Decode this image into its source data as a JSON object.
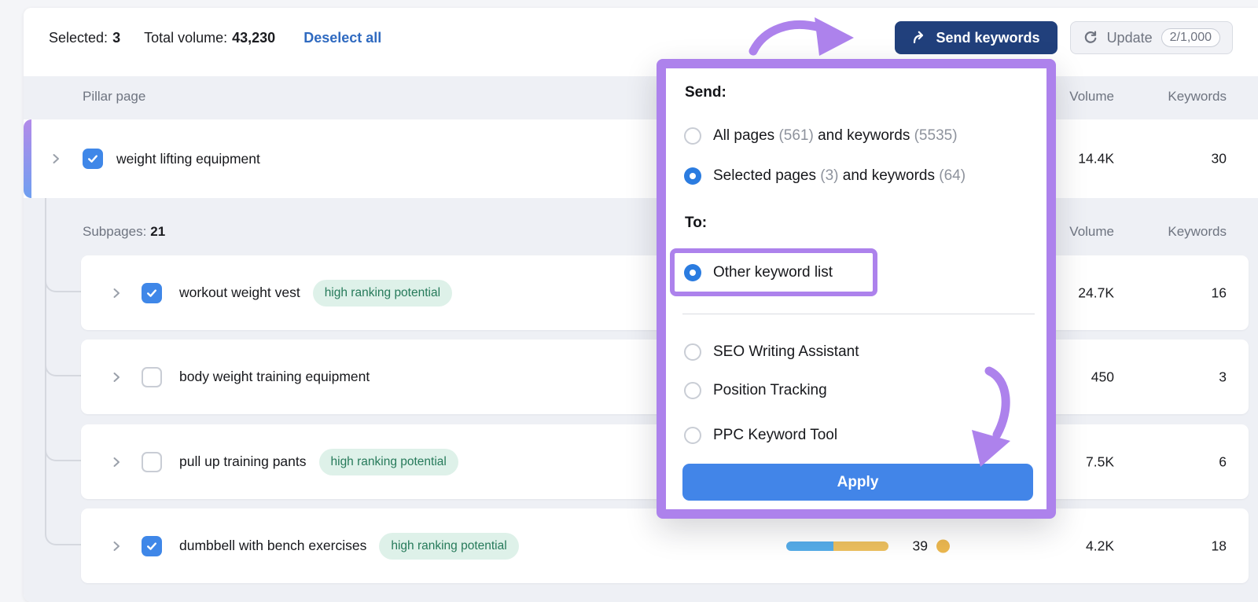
{
  "colors": {
    "annotation_purple": "#ad82ec",
    "send_button_navy": "#21407c",
    "apply_blue": "#4285e8",
    "checkbox_blue": "#3f87e8",
    "link_blue": "#2f6ac0",
    "badge_bg": "#def1e9",
    "badge_text": "#267a5a",
    "bar_blue": "#56ace8",
    "bar_yellow": "#ecbf5f",
    "dot_yellow": "#ecb84f"
  },
  "toolbar": {
    "selected_label": "Selected:",
    "selected_value": "3",
    "total_volume_label": "Total volume:",
    "total_volume_value": "43,230",
    "deselect_all": "Deselect all",
    "send_keywords": "Send keywords",
    "update": "Update",
    "update_quota": "2/1,000"
  },
  "table": {
    "pillar_header": "Pillar page",
    "volume_header": "Volume",
    "keywords_header": "Keywords",
    "pillar_row": {
      "label": "weight lifting equipment",
      "checked": true,
      "volume": "14.4K",
      "keywords": "30"
    },
    "subpages_label": "Subpages:",
    "subpages_count": "21",
    "subpage_rows": [
      {
        "label": "workout weight vest",
        "checked": true,
        "badge": "high ranking potential",
        "volume": "24.7K",
        "keywords": "16"
      },
      {
        "label": "body weight training equipment",
        "checked": false,
        "badge": null,
        "volume": "450",
        "keywords": "3"
      },
      {
        "label": "pull up training pants",
        "checked": false,
        "badge": "high ranking potential",
        "volume": "7.5K",
        "keywords": "6"
      },
      {
        "label": "dumbbell with bench exercises",
        "checked": true,
        "badge": "high ranking potential",
        "volume": "4.2K",
        "keywords": "18",
        "difficulty": "39",
        "bar_blue_pct": 46,
        "bar_yellow_pct": 54
      }
    ]
  },
  "popup": {
    "send_label": "Send:",
    "send_options": [
      {
        "t1": "All pages ",
        "c1": "(561) ",
        "t2": "and keywords ",
        "c2": "(5535)",
        "selected": false
      },
      {
        "t1": "Selected pages ",
        "c1": "(3) ",
        "t2": "and keywords ",
        "c2": "(64)",
        "selected": true
      }
    ],
    "to_label": "To:",
    "to_highlighted_option": "Other keyword list",
    "to_options": [
      "SEO Writing Assistant",
      "Position Tracking",
      "PPC Keyword Tool"
    ],
    "apply_label": "Apply"
  }
}
